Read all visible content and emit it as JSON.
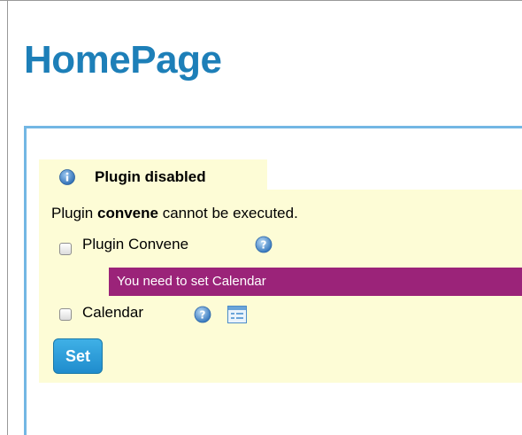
{
  "page": {
    "title": "HomePage"
  },
  "plugin_panel": {
    "tab_label": "Plugin disabled",
    "message_prefix": "Plugin ",
    "message_plugin_name": "convene",
    "message_suffix": " cannot be executed.",
    "rows": [
      {
        "label": "Plugin Convene",
        "checked": false
      },
      {
        "label": "Calendar",
        "checked": false
      }
    ],
    "error_message": "You need to set Calendar",
    "set_button_label": "Set"
  },
  "icons": {
    "info": "info-icon",
    "help": "help-icon",
    "calendar": "calendar-icon"
  },
  "colors": {
    "title": "#1d7fb8",
    "panel_background": "#fdfcd6",
    "error_background": "#9b2379",
    "border_accent": "#73b7e4",
    "button": "#2a9bd8"
  }
}
